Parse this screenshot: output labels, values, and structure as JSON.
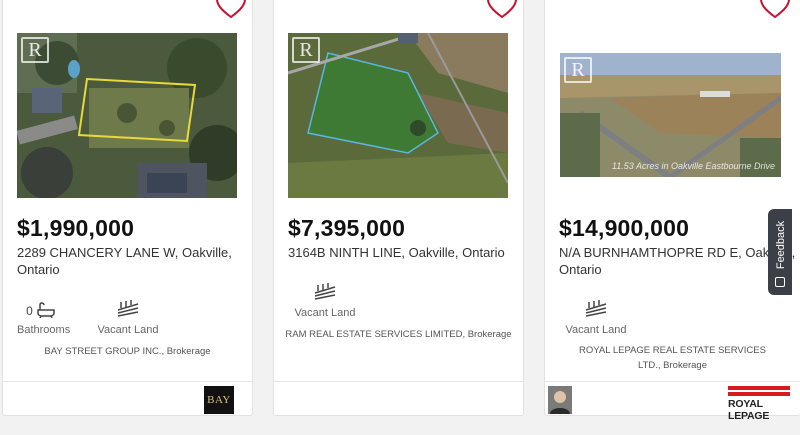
{
  "listings": [
    {
      "price": "$1,990,000",
      "address": "2289 CHANCERY LANE W, Oakville, Ontario",
      "features": [
        {
          "icon": "bathtub-icon",
          "count": "0",
          "label": "Bathrooms"
        },
        {
          "icon": "vacant-land-icon",
          "count": "",
          "label": "Vacant Land"
        }
      ],
      "brokerage": "BAY STREET GROUP INC., Brokerage",
      "logo_text": "BAY",
      "photo_overlay": ""
    },
    {
      "price": "$7,395,000",
      "address": "3164B NINTH LINE, Oakville, Ontario",
      "features": [
        {
          "icon": "vacant-land-icon",
          "count": "",
          "label": "Vacant Land"
        }
      ],
      "brokerage": "RAM REAL ESTATE SERVICES LIMITED, Brokerage",
      "photo_overlay": ""
    },
    {
      "price": "$14,900,000",
      "address": "N/A BURNHAMTHOPRE RD E, Oakville, Ontario",
      "features": [
        {
          "icon": "vacant-land-icon",
          "count": "",
          "label": "Vacant Land"
        }
      ],
      "brokerage": "ROYAL LEPAGE REAL ESTATE SERVICES LTD., Brokerage",
      "logo_text": "ROYAL LEPAGE",
      "photo_overlay": "11.53 Acres in Oakville Eastbourne Drive"
    }
  ],
  "realtor_mark": "R",
  "feedback_label": "Feedback",
  "colors": {
    "price": "#111111",
    "heart": "#c8102e",
    "feedback_bg": "#3b3f47",
    "royal_lepage_red": "#d71920"
  }
}
